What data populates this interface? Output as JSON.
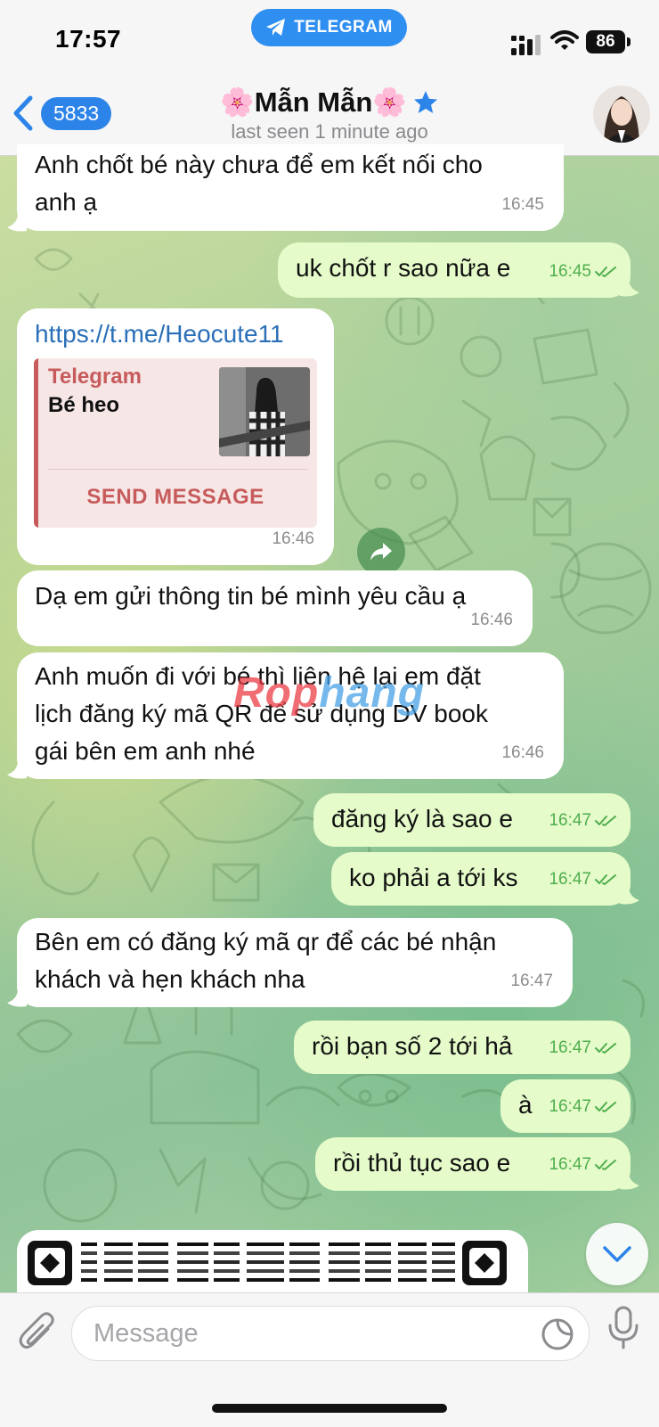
{
  "status_bar": {
    "time": "17:57",
    "app_pill": "TELEGRAM",
    "battery": "86"
  },
  "header": {
    "back_count": "5833",
    "title": "🌸Mẫn Mẫn🌸",
    "subtitle": "last seen 1 minute ago",
    "star_icon": "star-icon",
    "accent_color": "#2d84e8"
  },
  "messages": [
    {
      "dir": "in",
      "lines": [
        "Anh chốt bé này chưa để em kết nối cho",
        "anh ạ"
      ],
      "time": "16:45"
    },
    {
      "dir": "out",
      "lines": [
        "uk chốt r sao nữa e"
      ],
      "time": "16:45"
    },
    {
      "dir": "in",
      "type": "link",
      "link": "https://t.me/Heocute11",
      "preview": {
        "site": "Telegram",
        "title": "Bé heo",
        "button": "SEND MESSAGE"
      },
      "time": "16:46"
    },
    {
      "dir": "in",
      "lines": [
        "Dạ em gửi thông tin bé mình yêu cầu ạ"
      ],
      "time": "16:46"
    },
    {
      "dir": "in",
      "lines": [
        "Anh muốn đi với bé thì liên hệ lại em đặt",
        "lịch đăng ký mã QR để sử dụng DV book",
        "gái bên em anh nhé"
      ],
      "time": "16:46"
    },
    {
      "dir": "out",
      "lines": [
        "đăng ký là sao e"
      ],
      "time": "16:47"
    },
    {
      "dir": "out",
      "lines": [
        "ko phải a tới ks"
      ],
      "time": "16:47"
    },
    {
      "dir": "in",
      "lines": [
        "Bên em có đăng ký mã qr để các bé nhận",
        "khách và hẹn khách nha"
      ],
      "time": "16:47"
    },
    {
      "dir": "out",
      "lines": [
        "rồi bạn số 2 tới hả"
      ],
      "time": "16:47"
    },
    {
      "dir": "out",
      "lines": [
        "à"
      ],
      "time": "16:47"
    },
    {
      "dir": "out",
      "lines": [
        "rồi thủ tục sao e"
      ],
      "time": "16:47"
    }
  ],
  "watermark": {
    "part1": "Rop",
    "part2": "hang"
  },
  "input": {
    "placeholder": "Message"
  }
}
